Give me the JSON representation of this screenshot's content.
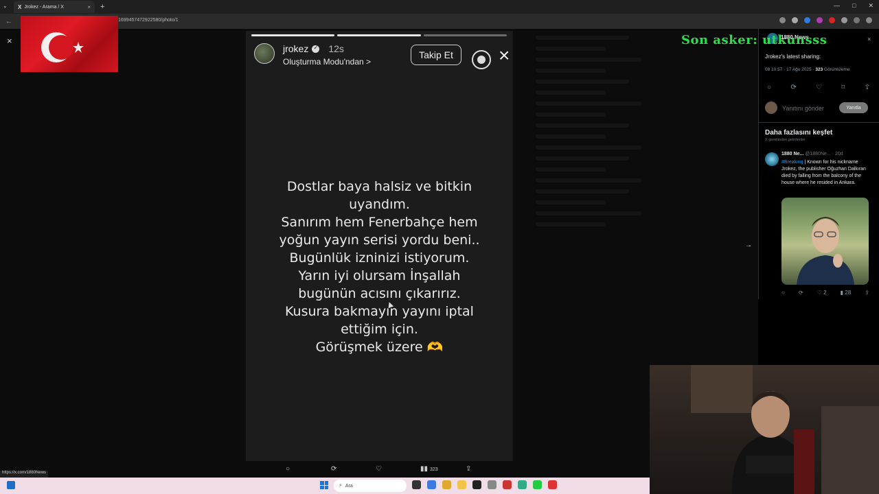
{
  "browser": {
    "tab_title": "Jrokez - Arama / X",
    "tab_close": "×",
    "new_tab": "+",
    "url": "1699457472922580/photo/1",
    "status_url": "https://x.com/1880News"
  },
  "viewer": {
    "close": "×"
  },
  "story": {
    "username": "jrokez",
    "time": "12s",
    "subtitle": "Oluşturma Modu'ndan >",
    "follow_label": "Takip Et",
    "close": "×",
    "progress_segments": 3,
    "lines": [
      "Dostlar baya halsiz ve bitkin",
      "uyandım.",
      "Sanırım hem Fenerbahçe hem",
      "yoğun yayın serisi yordu beni..",
      "Bugünlük izninizi istiyorum.",
      "Yarın iyi olursam İnşallah",
      "bugünün acısını çıkarırız.",
      "Kusura bakmayın yayını iptal",
      "ettiğim için.",
      "Görüşmek üzere 🫶"
    ]
  },
  "actions": {
    "views": "323"
  },
  "overlay": {
    "title": "Son asker: utkunsss"
  },
  "sidebar": {
    "user": "1880 News",
    "tweet_text": "Jrokez's latest sharing:",
    "meta_time": "08 10:57 · 17 Ağu 2025 · ",
    "meta_views": "323",
    "meta_views_label": " Görüntüleme",
    "reply_placeholder": "Yanıtını gönder",
    "reply_button": "Yanıtla",
    "explore_title": "Daha fazlasını keşfet",
    "explore_sub": "X genelinden getirilenler",
    "rec": {
      "name": "1880 Ne...",
      "handle": "@1880Ne... · 20d",
      "tag": "#Breaking",
      "body": " | Known for his nickname Jrokez, the publisher Oğuzhan Dalkıran died by falling from the balcony of the house where he resided in Ankara.",
      "likes": "2",
      "views": "28"
    }
  },
  "taskbar": {
    "search_label": "Ara"
  },
  "colors": {
    "overlay_green": "#27e04a",
    "flag_red": "#e01a24",
    "link_blue": "#1d9bf0"
  }
}
